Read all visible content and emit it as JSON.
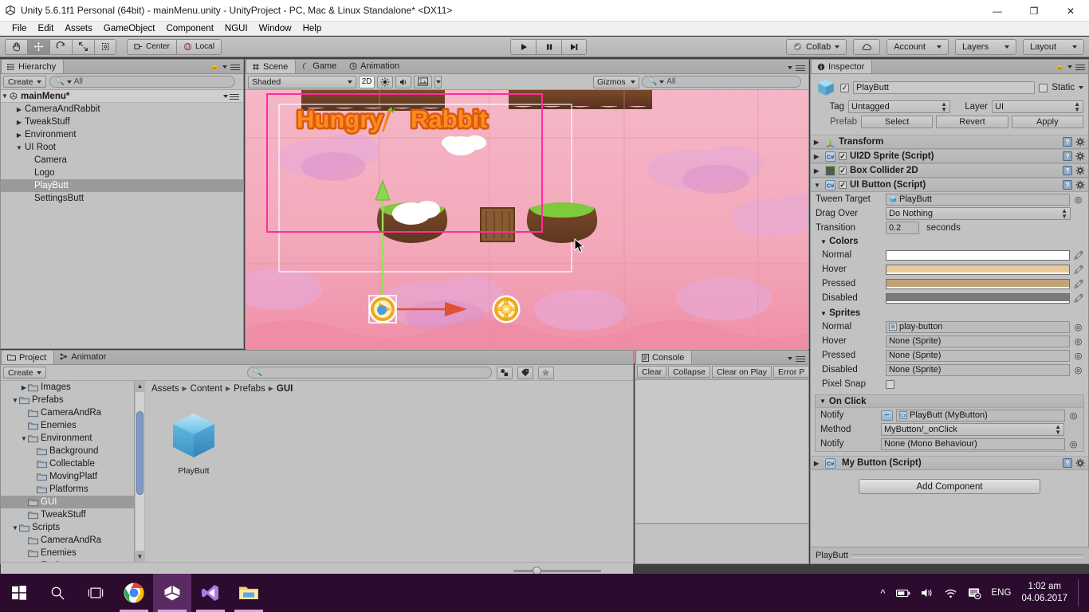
{
  "window": {
    "title": "Unity 5.6.1f1 Personal (64bit) - mainMenu.unity - UnityProject - PC, Mac & Linux Standalone* <DX11>",
    "minimize": "—",
    "restore": "❐",
    "close": "✕"
  },
  "menubar": {
    "items": [
      "File",
      "Edit",
      "Assets",
      "GameObject",
      "Component",
      "NGUI",
      "Window",
      "Help"
    ]
  },
  "toolbar": {
    "tools": [
      {
        "name": "hand-tool",
        "glyph": "✋"
      },
      {
        "name": "move-tool",
        "glyph": "✥"
      },
      {
        "name": "rotate-tool",
        "glyph": "↻"
      },
      {
        "name": "scale-tool",
        "glyph": "⤢"
      },
      {
        "name": "rect-tool",
        "glyph": "▣"
      }
    ],
    "pivot_label": "Center",
    "space_label": "Local",
    "play": "▶",
    "pause": "❚❚",
    "step": "▶|",
    "collab_label": "Collab",
    "cloud_label": "☁",
    "account_label": "Account",
    "layers_label": "Layers",
    "layout_label": "Layout"
  },
  "hierarchy": {
    "tab_label": "Hierarchy",
    "create_label": "Create",
    "search_placeholder": "All",
    "scene_name": "mainMenu*",
    "items": [
      {
        "label": "CameraAndRabbit",
        "indent": 1,
        "arrow": "▶",
        "selected": false
      },
      {
        "label": "TweakStuff",
        "indent": 1,
        "arrow": "▶",
        "selected": false
      },
      {
        "label": "Environment",
        "indent": 1,
        "arrow": "▶",
        "selected": false
      },
      {
        "label": "UI Root",
        "indent": 1,
        "arrow": "▼",
        "selected": false
      },
      {
        "label": "Camera",
        "indent": 2,
        "arrow": "",
        "selected": false
      },
      {
        "label": "Logo",
        "indent": 2,
        "arrow": "",
        "selected": false
      },
      {
        "label": "PlayButt",
        "indent": 2,
        "arrow": "",
        "selected": true
      },
      {
        "label": "SettingsButt",
        "indent": 2,
        "arrow": "",
        "selected": false
      }
    ]
  },
  "scene": {
    "tabs": [
      {
        "label": "Scene",
        "icon": "grid-icon",
        "selected": true
      },
      {
        "label": "Game",
        "icon": "gamepad-icon",
        "selected": false
      },
      {
        "label": "Animation",
        "icon": "clock-icon",
        "selected": false
      }
    ],
    "shading_mode": "Shaded",
    "mode_2d": "2D",
    "gizmos_label": "Gizmos",
    "search_placeholder": "All",
    "game_title_1": "Hungry",
    "game_title_2": "Rabbit"
  },
  "project": {
    "tabs": [
      {
        "label": "Project",
        "icon": "folder-icon",
        "selected": true
      },
      {
        "label": "Animator",
        "icon": "animator-icon",
        "selected": false
      }
    ],
    "create_label": "Create",
    "search_placeholder": "",
    "tree": [
      {
        "label": "Images",
        "indent": 2,
        "arrow": "▶",
        "selected": false
      },
      {
        "label": "Prefabs",
        "indent": 1,
        "arrow": "▼",
        "selected": false
      },
      {
        "label": "CameraAndRa",
        "indent": 2,
        "arrow": "",
        "selected": false
      },
      {
        "label": "Enemies",
        "indent": 2,
        "arrow": "",
        "selected": false
      },
      {
        "label": "Environment",
        "indent": 2,
        "arrow": "▼",
        "selected": false
      },
      {
        "label": "Background",
        "indent": 3,
        "arrow": "",
        "selected": false
      },
      {
        "label": "Collectable",
        "indent": 3,
        "arrow": "",
        "selected": false
      },
      {
        "label": "MovingPlatf",
        "indent": 3,
        "arrow": "",
        "selected": false
      },
      {
        "label": "Platforms",
        "indent": 3,
        "arrow": "",
        "selected": false
      },
      {
        "label": "GUI",
        "indent": 2,
        "arrow": "",
        "selected": true
      },
      {
        "label": "TweakStuff",
        "indent": 2,
        "arrow": "",
        "selected": false
      },
      {
        "label": "Scripts",
        "indent": 1,
        "arrow": "▼",
        "selected": false
      },
      {
        "label": "CameraAndRa",
        "indent": 2,
        "arrow": "",
        "selected": false
      },
      {
        "label": "Enemies",
        "indent": 2,
        "arrow": "",
        "selected": false
      },
      {
        "label": "Environment",
        "indent": 2,
        "arrow": "▼",
        "selected": false
      }
    ],
    "breadcrumb": [
      "Assets",
      "Content",
      "Prefabs",
      "GUI"
    ],
    "assets": [
      {
        "label": "PlayButt",
        "type": "prefab"
      }
    ]
  },
  "console": {
    "tab_label": "Console",
    "buttons": [
      "Clear",
      "Collapse",
      "Clear on Play",
      "Error P"
    ]
  },
  "inspector": {
    "tab_label": "Inspector",
    "object_name": "PlayButt",
    "enabled": true,
    "static_label": "Static",
    "tag_label": "Tag",
    "tag_value": "Untagged",
    "layer_label": "Layer",
    "layer_value": "UI",
    "prefab_label": "Prefab",
    "prefab_buttons": [
      "Select",
      "Revert",
      "Apply"
    ],
    "components": [
      {
        "name": "Transform",
        "expanded": false,
        "has_checkbox": false,
        "icon": "transform-icon"
      },
      {
        "name": "UI2D Sprite (Script)",
        "expanded": false,
        "has_checkbox": true,
        "checked": true,
        "icon": "script-icon"
      },
      {
        "name": "Box Collider 2D",
        "expanded": false,
        "has_checkbox": true,
        "checked": true,
        "icon": "collider-icon"
      },
      {
        "name": "UI Button (Script)",
        "expanded": true,
        "has_checkbox": true,
        "checked": true,
        "icon": "script-icon"
      }
    ],
    "ui_button": {
      "tween_target_label": "Tween Target",
      "tween_target_value": "PlayButt",
      "drag_over_label": "Drag Over",
      "drag_over_value": "Do Nothing",
      "transition_label": "Transition",
      "transition_value": "0.2",
      "transition_unit": "seconds",
      "colors_label": "Colors",
      "colors": [
        {
          "label": "Normal",
          "hex": "#ffffff"
        },
        {
          "label": "Hover",
          "hex": "#e8ca9a"
        },
        {
          "label": "Pressed",
          "hex": "#c0a478"
        },
        {
          "label": "Disabled",
          "hex": "#7a7a7a"
        }
      ],
      "sprites_label": "Sprites",
      "sprites": [
        {
          "label": "Normal",
          "value": "play-button",
          "has_icon": true
        },
        {
          "label": "Hover",
          "value": "None (Sprite)",
          "has_icon": false
        },
        {
          "label": "Pressed",
          "value": "None (Sprite)",
          "has_icon": false
        },
        {
          "label": "Disabled",
          "value": "None (Sprite)",
          "has_icon": false
        }
      ],
      "pixel_snap_label": "Pixel Snap",
      "pixel_snap_checked": false,
      "on_click_label": "On Click",
      "notify_label": "Notify",
      "notify_value": "PlayButt (MyButton)",
      "method_label": "Method",
      "method_value": "MyButton/_onClick",
      "notify2_label": "Notify",
      "notify2_value": "None (Mono Behaviour)"
    },
    "last_component": "My Button (Script)",
    "add_component_label": "Add Component",
    "footer_label": "PlayButt"
  },
  "taskbar": {
    "items": [
      {
        "name": "start-button",
        "active": false
      },
      {
        "name": "search-icon",
        "active": false
      },
      {
        "name": "task-view-icon",
        "active": false
      },
      {
        "name": "chrome-icon",
        "active": false
      },
      {
        "name": "unity-icon",
        "active": true
      },
      {
        "name": "visual-studio-icon",
        "active": false
      },
      {
        "name": "file-explorer-icon",
        "active": false
      }
    ],
    "tray": {
      "chevron": "⌃",
      "battery": "battery-icon",
      "volume": "volume-icon",
      "network": "wifi-icon",
      "action_center": "action-center-icon",
      "language": "ENG",
      "time": "1:02 am",
      "date": "04.06.2017"
    }
  },
  "colors": {
    "unity_panel_bg": "#c2c2c2",
    "selection": "#9a9a9a",
    "taskbar": "#2b0b2e",
    "selection_outline": "#ff2d9b"
  }
}
